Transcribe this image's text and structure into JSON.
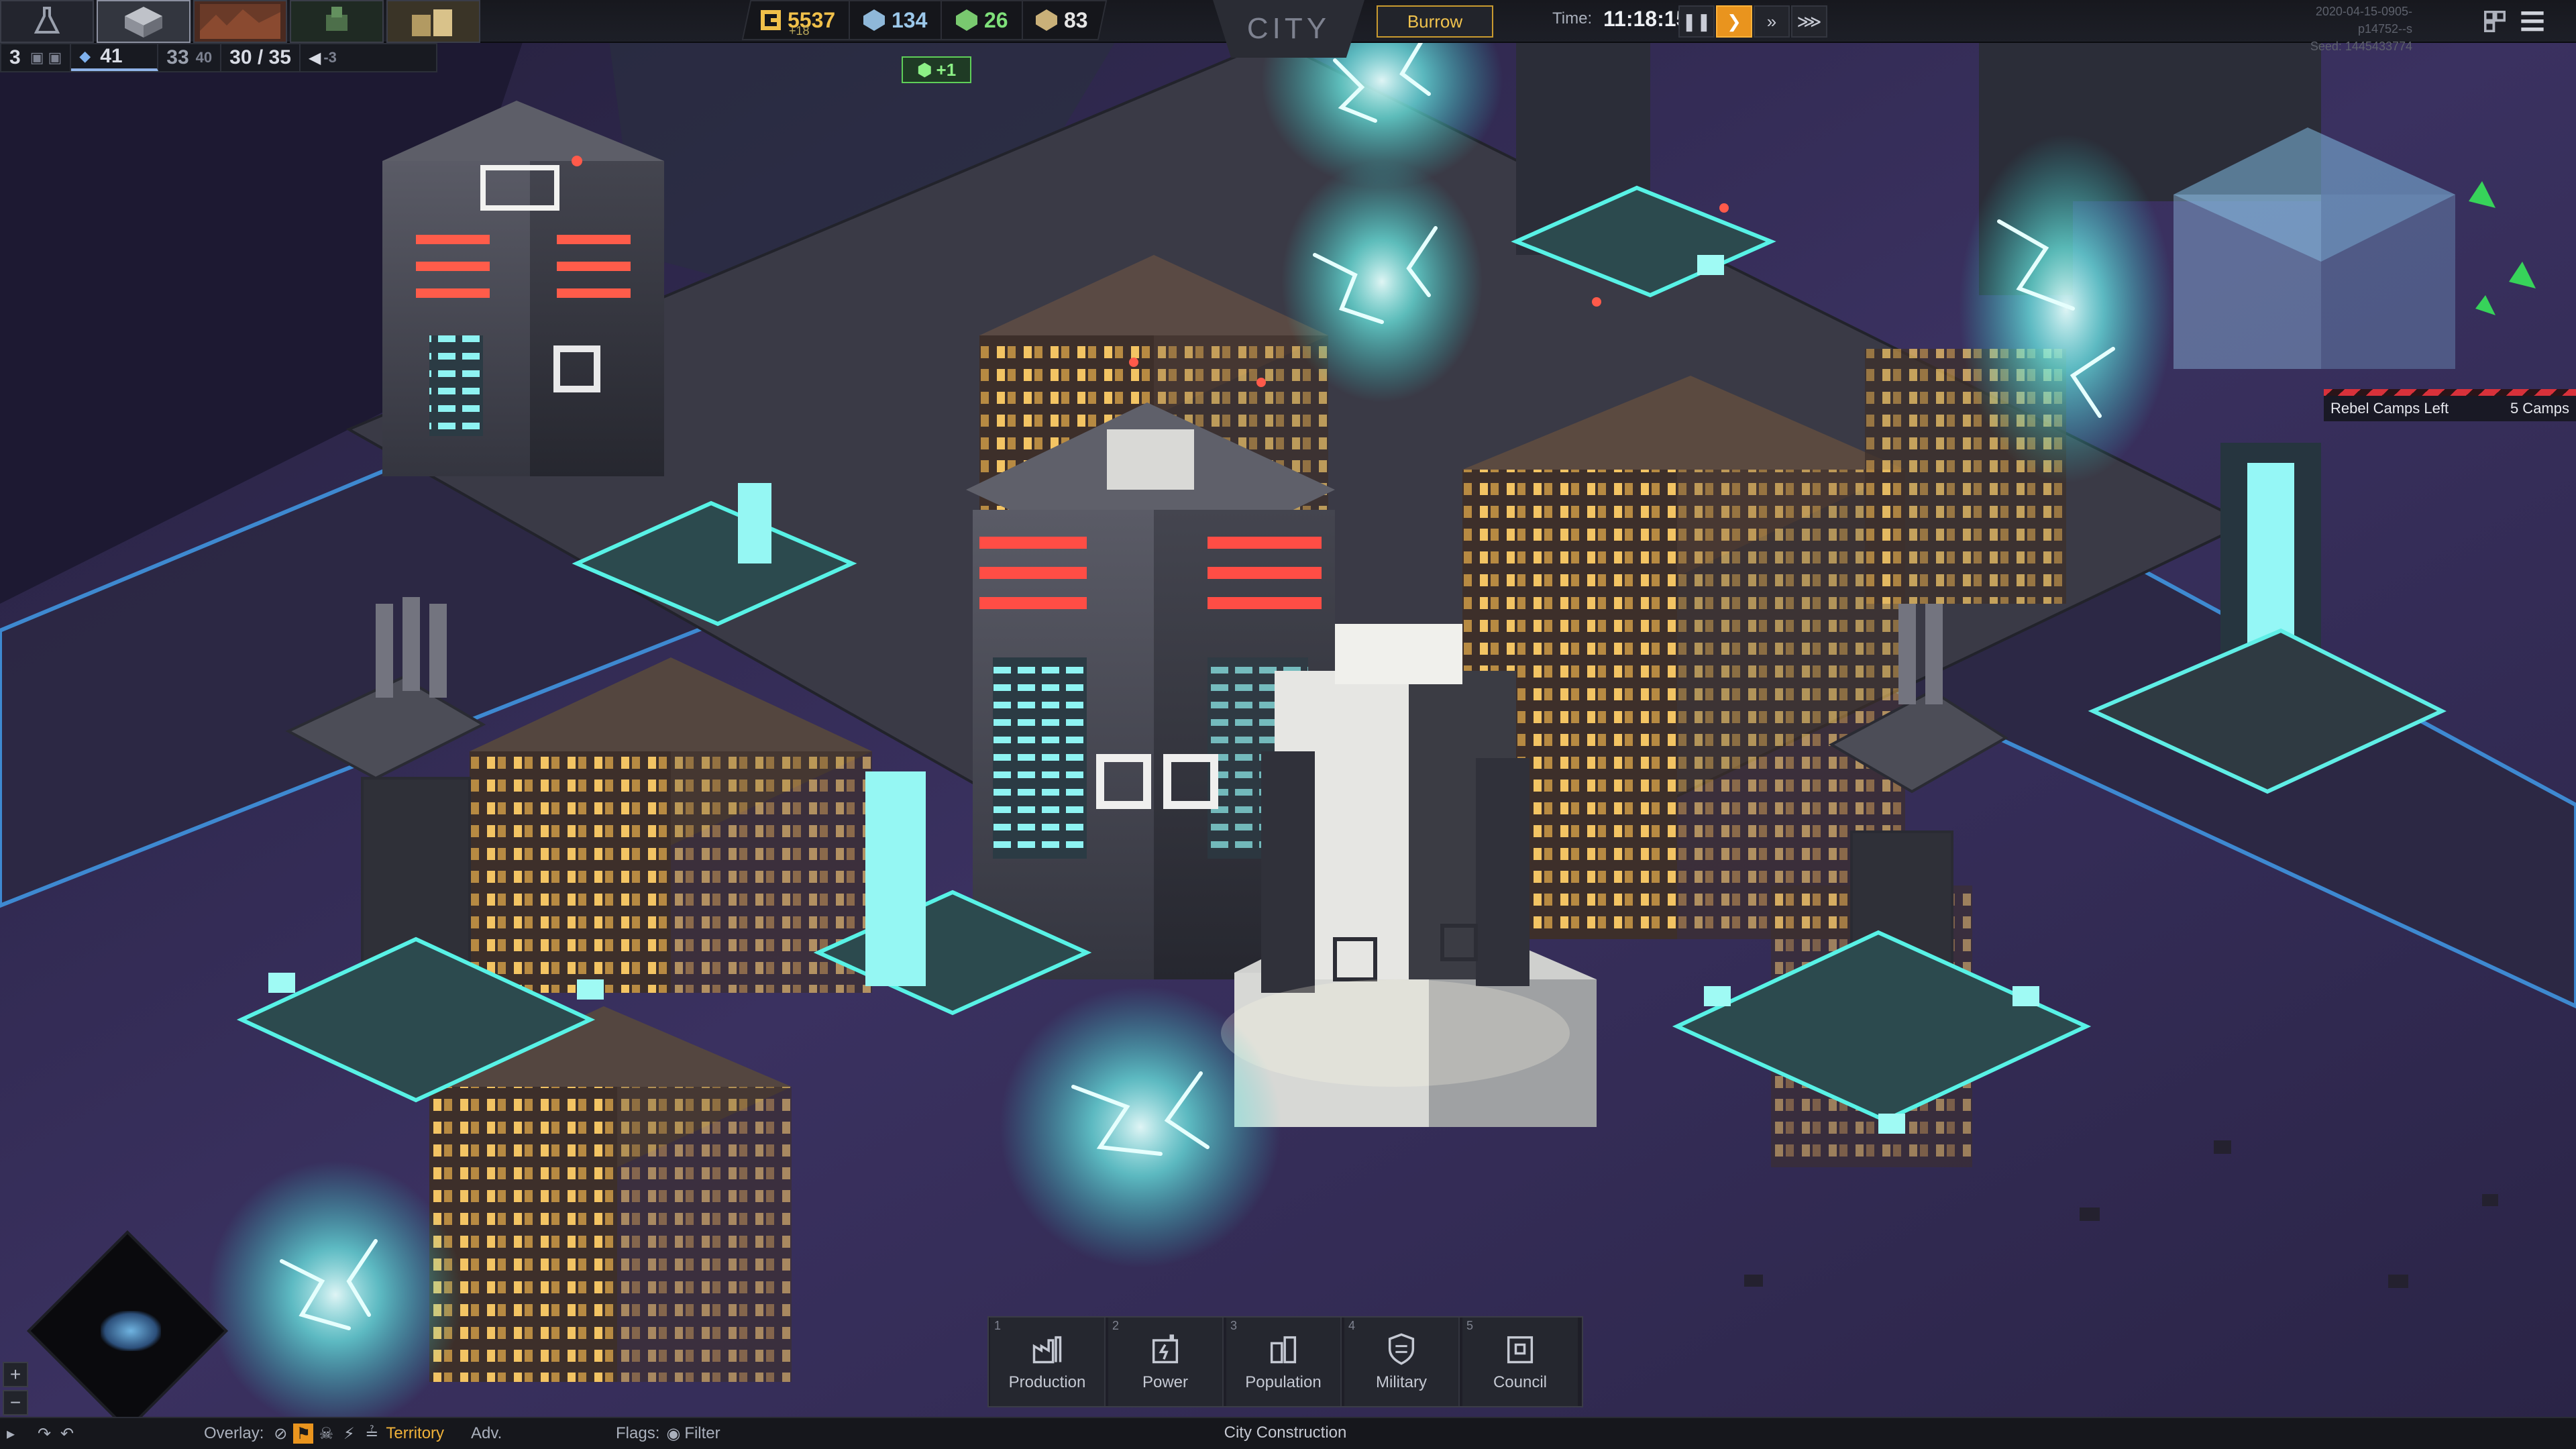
{
  "topbar": {
    "research_icon": "flask-icon",
    "category_tabs": [
      {
        "name": "city-core",
        "active": true
      },
      {
        "name": "terrain",
        "active": false
      },
      {
        "name": "units",
        "active": false
      },
      {
        "name": "structures",
        "active": false
      }
    ],
    "stats": {
      "tier": "3",
      "pop_current": "41",
      "housing_a": "33",
      "housing_b": "40",
      "capacity": "30 / 35",
      "signal": "-3"
    },
    "resources": {
      "credits": "5537",
      "credits_delta": "+18",
      "crystals": "134",
      "biomass": "26",
      "supplies": "83"
    },
    "city_tab": "CITY",
    "city_name": "Burrow",
    "time_label": "Time:",
    "time_value": "11:18:15",
    "speed_state": "play",
    "build_id": "2020-04-15-0905-p14752--s",
    "seed": "Seed: 1445433774"
  },
  "notification": "+1",
  "rebel_banner": {
    "label": "Rebel Camps Left",
    "value": "5 Camps"
  },
  "construction": {
    "title": "City Construction",
    "categories": [
      {
        "key": "1",
        "label": "Production",
        "icon": "factory-icon"
      },
      {
        "key": "2",
        "label": "Power",
        "icon": "power-plant-icon"
      },
      {
        "key": "3",
        "label": "Population",
        "icon": "housing-icon"
      },
      {
        "key": "4",
        "label": "Military",
        "icon": "shield-icon"
      },
      {
        "key": "5",
        "label": "Council",
        "icon": "council-icon"
      }
    ]
  },
  "bottom": {
    "overlay_label": "Overlay:",
    "territory_label": "Territory",
    "adv_label": "Adv.",
    "flags_label": "Flags:",
    "filter_label": "Filter"
  },
  "colors": {
    "accent_orange": "#e9941e",
    "burrow_gold": "#f0c24d",
    "neon_cyan": "#5ff4ea",
    "window_amber": "#f3c463",
    "alert_red": "#d8313a",
    "ground_purple": "#2f2950"
  }
}
